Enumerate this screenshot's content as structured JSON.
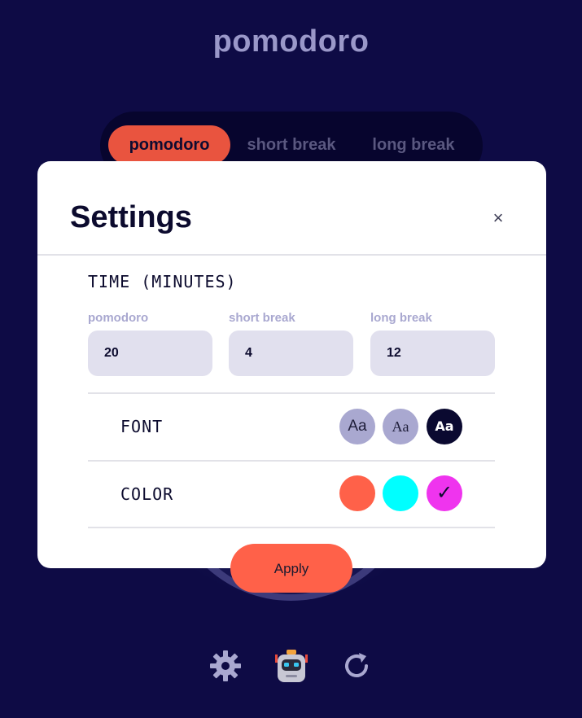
{
  "app": {
    "title": "pomodoro"
  },
  "modes": {
    "items": [
      {
        "label": "pomodoro",
        "active": true
      },
      {
        "label": "short break",
        "active": false
      },
      {
        "label": "long break",
        "active": false
      }
    ]
  },
  "settings": {
    "title": "Settings",
    "close_label": "×",
    "time_section": "TIME (MINUTES)",
    "fields": [
      {
        "label": "pomodoro",
        "value": "20"
      },
      {
        "label": "short break",
        "value": "4"
      },
      {
        "label": "long break",
        "value": "12"
      }
    ],
    "font_label": "FONT",
    "font_options": [
      {
        "glyph": "Aa",
        "family": "sans",
        "selected": false
      },
      {
        "glyph": "Aa",
        "family": "serif",
        "selected": false
      },
      {
        "glyph": "Aa",
        "family": "sans-bold",
        "selected": true
      }
    ],
    "color_label": "COLOR",
    "color_options": [
      {
        "hex": "#ff6149",
        "selected": false,
        "mark": ""
      },
      {
        "hex": "#00ffff",
        "selected": false,
        "mark": ""
      },
      {
        "hex": "#ef34ee",
        "selected": true,
        "mark": "✓"
      }
    ],
    "apply_label": "Apply"
  },
  "bottom_bar": {
    "icons": [
      "gear-icon",
      "robot-icon",
      "refresh-icon"
    ]
  },
  "colors": {
    "background": "#0e0b45",
    "accent": "#e9543f",
    "apply": "#ff6149"
  }
}
